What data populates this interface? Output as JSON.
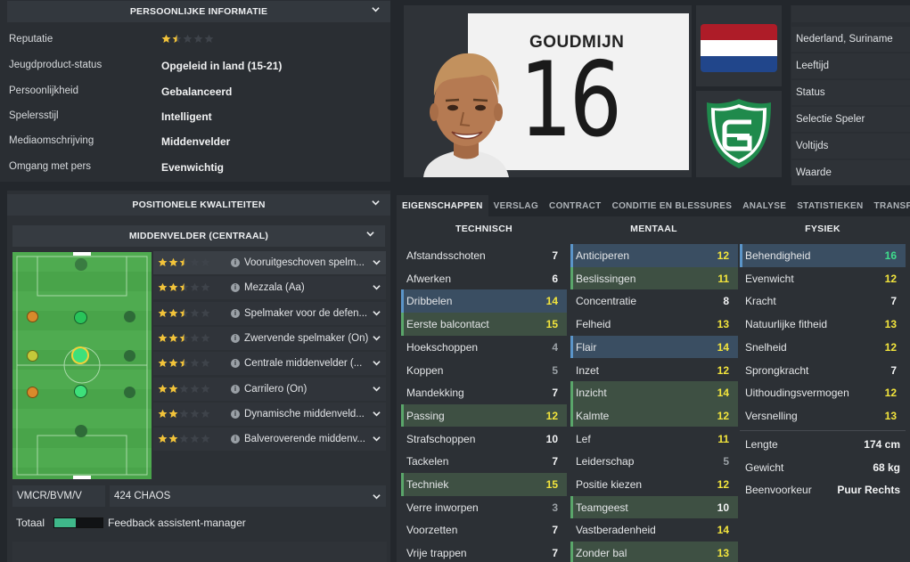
{
  "personal": {
    "header": "PERSOONLIJKE INFORMATIE",
    "reputation_stars": 1.5,
    "rows": [
      {
        "label": "Reputatie",
        "value": ""
      },
      {
        "label": "Jeugdproduct-status",
        "value": "Opgeleid in land (15-21)"
      },
      {
        "label": "Persoonlijkheid",
        "value": "Gebalanceerd"
      },
      {
        "label": "Spelersstijl",
        "value": "Intelligent"
      },
      {
        "label": "Mediaomschrijving",
        "value": "Middenvelder"
      },
      {
        "label": "Omgang met pers",
        "value": "Evenwichtig"
      }
    ]
  },
  "positional": {
    "header": "POSITIONELE KWALITEITEN",
    "position_header": "MIDDENVELDER (CENTRAAL)",
    "roles": [
      {
        "name": "Vooruitgeschoven spelm...",
        "stars": 2.5
      },
      {
        "name": "Mezzala (Aa)",
        "stars": 2.5
      },
      {
        "name": "Spelmaker voor de defen...",
        "stars": 2.5
      },
      {
        "name": "Zwervende spelmaker (On)",
        "stars": 2.5
      },
      {
        "name": "Centrale middenvelder (...",
        "stars": 2.5
      },
      {
        "name": "Carrilero (On)",
        "stars": 2
      },
      {
        "name": "Dynamische middenveld...",
        "stars": 2
      },
      {
        "name": "Balveroverende middenv...",
        "stars": 2
      }
    ],
    "positions_select": "VMCR/BVM/V",
    "tactic_select": "424 CHAOS",
    "total_label": "Totaal",
    "total_level": 0.45,
    "feedback_label": "Feedback assistent-manager"
  },
  "player": {
    "shirt_name": "GOUDMIJN",
    "shirt_number": "16",
    "nationality": "Nederland, Suriname",
    "info_labels": [
      "Leeftijd",
      "Status",
      "Selectie Speler",
      "Voltijds",
      "Waarde"
    ]
  },
  "tabs": [
    "EIGENSCHAPPEN",
    "VERSLAG",
    "CONTRACT",
    "CONDITIE EN BLESSURES",
    "ANALYSE",
    "STATISTIEKEN",
    "TRANSFERS"
  ],
  "attributes": {
    "technical_header": "TECHNISCH",
    "mental_header": "MENTAAL",
    "physical_header": "FYSIEK",
    "technical": [
      {
        "name": "Afstandsschoten",
        "value": "7",
        "color": "white",
        "hl": ""
      },
      {
        "name": "Afwerken",
        "value": "6",
        "color": "white",
        "hl": ""
      },
      {
        "name": "Dribbelen",
        "value": "14",
        "color": "yellow",
        "hl": "blue"
      },
      {
        "name": "Eerste balcontact",
        "value": "15",
        "color": "yellow",
        "hl": "green"
      },
      {
        "name": "Hoekschoppen",
        "value": "4",
        "color": "grey",
        "hl": ""
      },
      {
        "name": "Koppen",
        "value": "5",
        "color": "grey",
        "hl": ""
      },
      {
        "name": "Mandekking",
        "value": "7",
        "color": "white",
        "hl": ""
      },
      {
        "name": "Passing",
        "value": "12",
        "color": "yellow",
        "hl": "green"
      },
      {
        "name": "Strafschoppen",
        "value": "10",
        "color": "white",
        "hl": ""
      },
      {
        "name": "Tackelen",
        "value": "7",
        "color": "white",
        "hl": ""
      },
      {
        "name": "Techniek",
        "value": "15",
        "color": "yellow",
        "hl": "green"
      },
      {
        "name": "Verre inworpen",
        "value": "3",
        "color": "grey",
        "hl": ""
      },
      {
        "name": "Voorzetten",
        "value": "7",
        "color": "white",
        "hl": ""
      },
      {
        "name": "Vrije trappen",
        "value": "7",
        "color": "white",
        "hl": ""
      }
    ],
    "mental": [
      {
        "name": "Anticiperen",
        "value": "12",
        "color": "yellow",
        "hl": "blue"
      },
      {
        "name": "Beslissingen",
        "value": "11",
        "color": "yellow",
        "hl": "green"
      },
      {
        "name": "Concentratie",
        "value": "8",
        "color": "white",
        "hl": ""
      },
      {
        "name": "Felheid",
        "value": "13",
        "color": "yellow",
        "hl": ""
      },
      {
        "name": "Flair",
        "value": "14",
        "color": "yellow",
        "hl": "blue"
      },
      {
        "name": "Inzet",
        "value": "12",
        "color": "yellow",
        "hl": ""
      },
      {
        "name": "Inzicht",
        "value": "14",
        "color": "yellow",
        "hl": "green"
      },
      {
        "name": "Kalmte",
        "value": "12",
        "color": "yellow",
        "hl": "green"
      },
      {
        "name": "Lef",
        "value": "11",
        "color": "yellow",
        "hl": ""
      },
      {
        "name": "Leiderschap",
        "value": "5",
        "color": "grey",
        "hl": ""
      },
      {
        "name": "Positie kiezen",
        "value": "12",
        "color": "yellow",
        "hl": ""
      },
      {
        "name": "Teamgeest",
        "value": "10",
        "color": "white",
        "hl": "green"
      },
      {
        "name": "Vastberadenheid",
        "value": "14",
        "color": "yellow",
        "hl": ""
      },
      {
        "name": "Zonder bal",
        "value": "13",
        "color": "yellow",
        "hl": "green"
      }
    ],
    "physical": [
      {
        "name": "Behendigheid",
        "value": "16",
        "color": "green",
        "hl": "blue"
      },
      {
        "name": "Evenwicht",
        "value": "12",
        "color": "yellow",
        "hl": ""
      },
      {
        "name": "Kracht",
        "value": "7",
        "color": "white",
        "hl": ""
      },
      {
        "name": "Natuurlijke fitheid",
        "value": "13",
        "color": "yellow",
        "hl": ""
      },
      {
        "name": "Snelheid",
        "value": "12",
        "color": "yellow",
        "hl": ""
      },
      {
        "name": "Sprongkracht",
        "value": "7",
        "color": "white",
        "hl": ""
      },
      {
        "name": "Uithoudingsvermogen",
        "value": "12",
        "color": "yellow",
        "hl": ""
      },
      {
        "name": "Versnelling",
        "value": "13",
        "color": "yellow",
        "hl": ""
      }
    ],
    "extra": [
      {
        "name": "Lengte",
        "value": "174 cm"
      },
      {
        "name": "Gewicht",
        "value": "68 kg"
      },
      {
        "name": "Beenvoorkeur",
        "value": "Puur Rechts"
      }
    ]
  },
  "colors": {
    "yellow": "#f2e43c",
    "green": "#3fdc8c",
    "blue_highlight": "#3a4e62",
    "green_highlight": "#3e5043",
    "club_green": "#1f8a4c",
    "pitch": "#4aa54a"
  }
}
